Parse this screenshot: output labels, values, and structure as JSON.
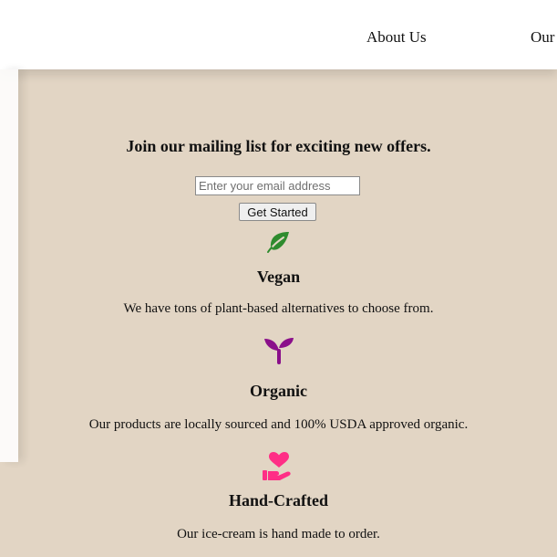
{
  "nav": {
    "about_label": "About Us",
    "our_label": "Our"
  },
  "signup": {
    "heading": "Join our mailing list for exciting new offers.",
    "email_placeholder": "Enter your email address",
    "button_label": "Get Started"
  },
  "features": [
    {
      "icon": "leaf-icon",
      "color": "#2e8b2e",
      "title": "Vegan",
      "text": "We have tons of plant-based alternatives to choose from."
    },
    {
      "icon": "seedling-icon",
      "color": "#8a0f8a",
      "title": "Organic",
      "text": "Our products are locally sourced and 100% USDA approved organic."
    },
    {
      "icon": "hand-heart-icon",
      "color": "#ff2e86",
      "title": "Hand-Crafted",
      "text": "Our ice-cream is hand made to order."
    }
  ],
  "colors": {
    "background": "#e2d5c4",
    "header": "#ffffff"
  }
}
